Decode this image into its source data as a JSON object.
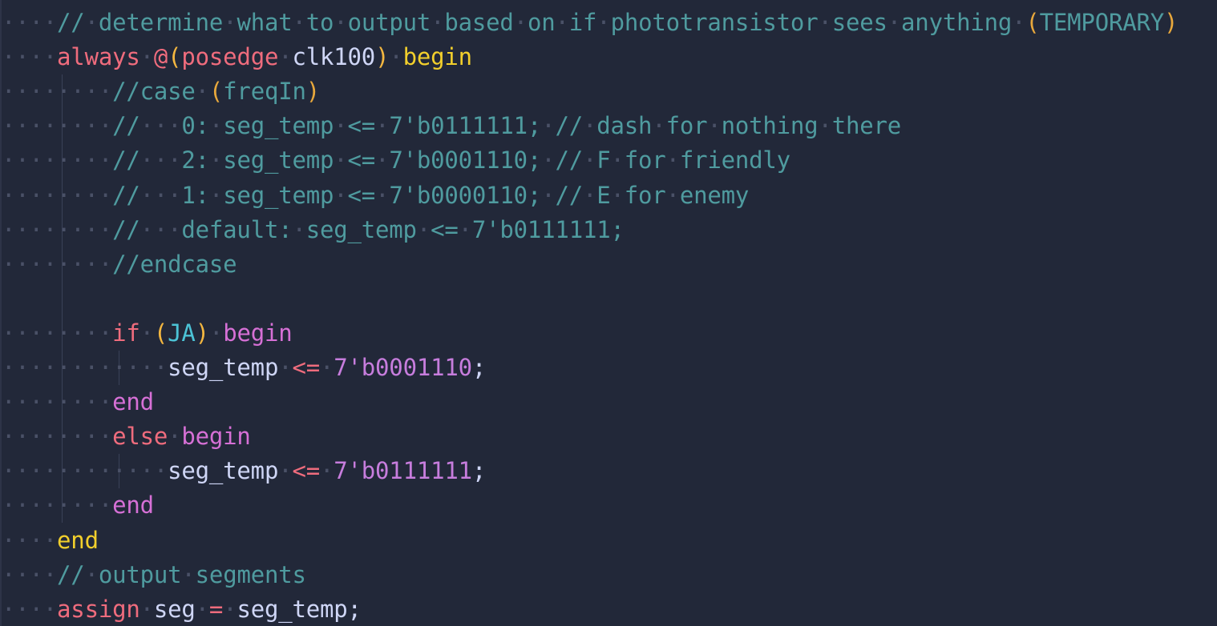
{
  "colors": {
    "background": "#222839",
    "whitespace": "#4a5167",
    "comment": "#4f9b9f",
    "comment_paren": "#e8a83c",
    "keyword": "#ef6c7d",
    "begin_top": "#f2cf2c",
    "begin_end": "#d670d6",
    "paren": "#f4b740",
    "identifier": "#cfd6f6",
    "number": "#c77ddd",
    "punct": "#cfd6f6",
    "macro_id": "#4cc3d6"
  },
  "lines": [
    {
      "indent": 1,
      "tokens": [
        [
          "comment",
          "//"
        ],
        [
          "ws",
          "·"
        ],
        [
          "comment",
          "determine"
        ],
        [
          "ws",
          "·"
        ],
        [
          "comment",
          "what"
        ],
        [
          "ws",
          "·"
        ],
        [
          "comment",
          "to"
        ],
        [
          "ws",
          "·"
        ],
        [
          "comment",
          "output"
        ],
        [
          "ws",
          "·"
        ],
        [
          "comment",
          "based"
        ],
        [
          "ws",
          "·"
        ],
        [
          "comment",
          "on"
        ],
        [
          "ws",
          "·"
        ],
        [
          "comment",
          "if"
        ],
        [
          "ws",
          "·"
        ],
        [
          "comment",
          "phototransistor"
        ],
        [
          "ws",
          "·"
        ],
        [
          "comment",
          "sees"
        ],
        [
          "ws",
          "·"
        ],
        [
          "comment",
          "anything"
        ],
        [
          "ws",
          "·"
        ],
        [
          "comment_paren",
          "("
        ],
        [
          "comment",
          "TEMPORARY"
        ],
        [
          "comment_paren",
          ")"
        ]
      ]
    },
    {
      "indent": 1,
      "tokens": [
        [
          "keyword",
          "always"
        ],
        [
          "ws",
          "·"
        ],
        [
          "keyword",
          "@"
        ],
        [
          "paren",
          "("
        ],
        [
          "keyword",
          "posedge"
        ],
        [
          "ws",
          "·"
        ],
        [
          "identifier",
          "clk100"
        ],
        [
          "paren",
          ")"
        ],
        [
          "ws",
          "·"
        ],
        [
          "begin_top",
          "begin"
        ]
      ]
    },
    {
      "indent": 2,
      "tokens": [
        [
          "comment",
          "//case"
        ],
        [
          "ws",
          "·"
        ],
        [
          "comment_paren",
          "("
        ],
        [
          "comment",
          "freqIn"
        ],
        [
          "comment_paren",
          ")"
        ]
      ]
    },
    {
      "indent": 2,
      "tokens": [
        [
          "comment",
          "//"
        ],
        [
          "ws",
          "···"
        ],
        [
          "comment",
          "0:"
        ],
        [
          "ws",
          "·"
        ],
        [
          "comment",
          "seg_temp"
        ],
        [
          "ws",
          "·"
        ],
        [
          "comment",
          "<="
        ],
        [
          "ws",
          "·"
        ],
        [
          "comment",
          "7'b0111111;"
        ],
        [
          "ws",
          "·"
        ],
        [
          "comment",
          "//"
        ],
        [
          "ws",
          "·"
        ],
        [
          "comment",
          "dash"
        ],
        [
          "ws",
          "·"
        ],
        [
          "comment",
          "for"
        ],
        [
          "ws",
          "·"
        ],
        [
          "comment",
          "nothing"
        ],
        [
          "ws",
          "·"
        ],
        [
          "comment",
          "there"
        ]
      ]
    },
    {
      "indent": 2,
      "tokens": [
        [
          "comment",
          "//"
        ],
        [
          "ws",
          "···"
        ],
        [
          "comment",
          "2:"
        ],
        [
          "ws",
          "·"
        ],
        [
          "comment",
          "seg_temp"
        ],
        [
          "ws",
          "·"
        ],
        [
          "comment",
          "<="
        ],
        [
          "ws",
          "·"
        ],
        [
          "comment",
          "7'b0001110;"
        ],
        [
          "ws",
          "·"
        ],
        [
          "comment",
          "//"
        ],
        [
          "ws",
          "·"
        ],
        [
          "comment",
          "F"
        ],
        [
          "ws",
          "·"
        ],
        [
          "comment",
          "for"
        ],
        [
          "ws",
          "·"
        ],
        [
          "comment",
          "friendly"
        ]
      ]
    },
    {
      "indent": 2,
      "tokens": [
        [
          "comment",
          "//"
        ],
        [
          "ws",
          "···"
        ],
        [
          "comment",
          "1:"
        ],
        [
          "ws",
          "·"
        ],
        [
          "comment",
          "seg_temp"
        ],
        [
          "ws",
          "·"
        ],
        [
          "comment",
          "<="
        ],
        [
          "ws",
          "·"
        ],
        [
          "comment",
          "7'b0000110;"
        ],
        [
          "ws",
          "·"
        ],
        [
          "comment",
          "//"
        ],
        [
          "ws",
          "·"
        ],
        [
          "comment",
          "E"
        ],
        [
          "ws",
          "·"
        ],
        [
          "comment",
          "for"
        ],
        [
          "ws",
          "·"
        ],
        [
          "comment",
          "enemy"
        ]
      ]
    },
    {
      "indent": 2,
      "tokens": [
        [
          "comment",
          "//"
        ],
        [
          "ws",
          "···"
        ],
        [
          "comment",
          "default:"
        ],
        [
          "ws",
          "·"
        ],
        [
          "comment",
          "seg_temp"
        ],
        [
          "ws",
          "·"
        ],
        [
          "comment",
          "<="
        ],
        [
          "ws",
          "·"
        ],
        [
          "comment",
          "7'b0111111;"
        ]
      ]
    },
    {
      "indent": 2,
      "tokens": [
        [
          "comment",
          "//endcase"
        ]
      ]
    },
    {
      "indent": 0,
      "tokens": []
    },
    {
      "indent": 2,
      "tokens": [
        [
          "keyword",
          "if"
        ],
        [
          "ws",
          "·"
        ],
        [
          "paren",
          "("
        ],
        [
          "macro_id",
          "JA"
        ],
        [
          "paren",
          ")"
        ],
        [
          "ws",
          "·"
        ],
        [
          "begin_end",
          "begin"
        ]
      ]
    },
    {
      "indent": 3,
      "tokens": [
        [
          "identifier",
          "seg_temp"
        ],
        [
          "ws",
          "·"
        ],
        [
          "keyword",
          "<="
        ],
        [
          "ws",
          "·"
        ],
        [
          "number",
          "7'b0001110"
        ],
        [
          "punct",
          ";"
        ]
      ]
    },
    {
      "indent": 2,
      "tokens": [
        [
          "begin_end",
          "end"
        ]
      ]
    },
    {
      "indent": 2,
      "tokens": [
        [
          "keyword",
          "else"
        ],
        [
          "ws",
          "·"
        ],
        [
          "begin_end",
          "begin"
        ]
      ]
    },
    {
      "indent": 3,
      "tokens": [
        [
          "identifier",
          "seg_temp"
        ],
        [
          "ws",
          "·"
        ],
        [
          "keyword",
          "<="
        ],
        [
          "ws",
          "·"
        ],
        [
          "number",
          "7'b0111111"
        ],
        [
          "punct",
          ";"
        ]
      ]
    },
    {
      "indent": 2,
      "tokens": [
        [
          "begin_end",
          "end"
        ]
      ]
    },
    {
      "indent": 1,
      "tokens": [
        [
          "begin_top",
          "end"
        ]
      ]
    },
    {
      "indent": 1,
      "tokens": [
        [
          "comment",
          "//"
        ],
        [
          "ws",
          "·"
        ],
        [
          "comment",
          "output"
        ],
        [
          "ws",
          "·"
        ],
        [
          "comment",
          "segments"
        ]
      ]
    },
    {
      "indent": 1,
      "tokens": [
        [
          "keyword",
          "assign"
        ],
        [
          "ws",
          "·"
        ],
        [
          "identifier",
          "seg"
        ],
        [
          "ws",
          "·"
        ],
        [
          "keyword",
          "="
        ],
        [
          "ws",
          "·"
        ],
        [
          "identifier",
          "seg_temp"
        ],
        [
          "punct",
          ";"
        ]
      ]
    }
  ]
}
